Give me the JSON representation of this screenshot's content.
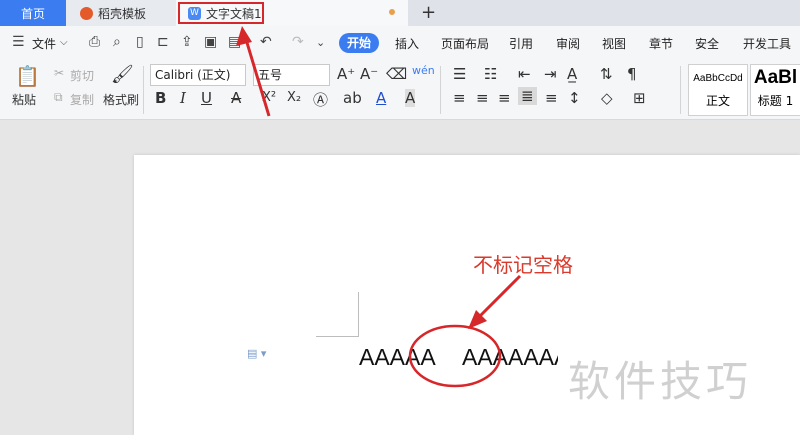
{
  "tabs": {
    "home": "首页",
    "template": "稻壳模板",
    "document": "文字文稿1",
    "doc_icon": "W",
    "new_tab": "+"
  },
  "menu": {
    "file": "文件",
    "items": [
      "开始",
      "插入",
      "页面布局",
      "引用",
      "审阅",
      "视图",
      "章节",
      "安全",
      "开发工具"
    ]
  },
  "ribbon": {
    "paste": "粘贴",
    "cut": "剪切",
    "copy": "复制",
    "format_painter": "格式刷",
    "font_name": "Calibri (正文)",
    "font_size": "五号",
    "bold": "B",
    "italic": "I",
    "underline": "U",
    "strike": "A",
    "superscript": "X²",
    "subscript": "X₂",
    "style_normal_preview": "AaBbCcDd",
    "style_normal": "正文",
    "style_h1_preview": "AaBl",
    "style_h1": "标题 1"
  },
  "document": {
    "text_before": "AAAAA",
    "text_after": "AAAAAAA"
  },
  "annotation": "不标记空格",
  "watermark": "软件技巧",
  "colors": {
    "accent": "#3b7df1",
    "annotation_red": "#d93a2b"
  }
}
